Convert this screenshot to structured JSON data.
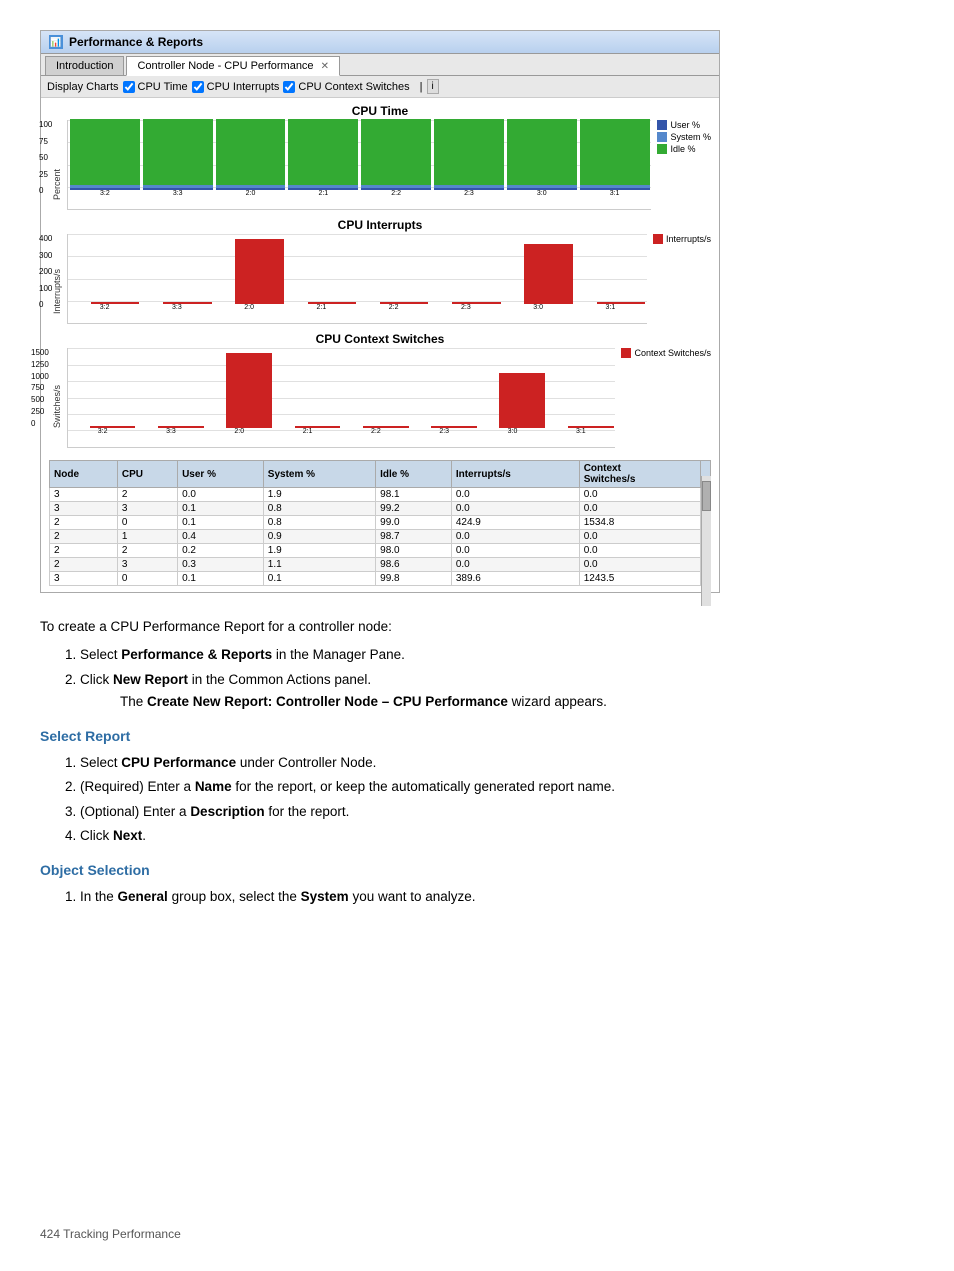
{
  "window": {
    "title": "Performance & Reports",
    "icon": "chart-icon",
    "tabs": [
      {
        "label": "Introduction",
        "active": false
      },
      {
        "label": "Controller Node - CPU Performance",
        "active": true,
        "closable": true
      }
    ]
  },
  "toolbar": {
    "label": "Display Charts",
    "checkboxes": [
      {
        "label": "CPU Time",
        "checked": true
      },
      {
        "label": "CPU Interrupts",
        "checked": true
      },
      {
        "label": "CPU Context Switches",
        "checked": true
      }
    ],
    "button": "i"
  },
  "charts": [
    {
      "title": "CPU Time",
      "ylabel": "Percent",
      "ylabels": [
        "100",
        "75",
        "50",
        "25",
        "0"
      ],
      "legend": [
        {
          "label": "User %",
          "color": "#3355aa"
        },
        {
          "label": "System %",
          "color": "#5588cc"
        },
        {
          "label": "Idle %",
          "color": "#33aa33"
        }
      ],
      "xLabels": [
        "3:2",
        "3:3",
        "2:0",
        "2:1",
        "2:2",
        "2:3",
        "3:0",
        "3:1"
      ],
      "bars": [
        {
          "user": 2,
          "system": 3,
          "idle": 95
        },
        {
          "user": 2,
          "system": 3,
          "idle": 95
        },
        {
          "user": 2,
          "system": 3,
          "idle": 95
        },
        {
          "user": 2,
          "system": 3,
          "idle": 95
        },
        {
          "user": 2,
          "system": 3,
          "idle": 95
        },
        {
          "user": 2,
          "system": 3,
          "idle": 95
        },
        {
          "user": 2,
          "system": 3,
          "idle": 95
        },
        {
          "user": 2,
          "system": 3,
          "idle": 95
        }
      ]
    },
    {
      "title": "CPU Interrupts",
      "ylabel": "Interrupts/s",
      "ylabels": [
        "400",
        "300",
        "200",
        "100",
        "0"
      ],
      "legend": [
        {
          "label": "Interrupts/s",
          "color": "#cc2222"
        }
      ],
      "xLabels": [
        "3:2",
        "3:3",
        "2:0",
        "2:1",
        "2:2",
        "2:3",
        "3:0",
        "3:1"
      ]
    },
    {
      "title": "CPU Context Switches",
      "ylabel": "Switches/s",
      "ylabels": [
        "1500",
        "1250",
        "1000",
        "750",
        "500",
        "250",
        "0"
      ],
      "legend": [
        {
          "label": "Context Switches/s",
          "color": "#cc2222"
        }
      ],
      "xLabels": [
        "3:2",
        "3:3",
        "2:0",
        "2:1",
        "2:2",
        "2:3",
        "3:0",
        "3:1"
      ]
    }
  ],
  "table": {
    "headers": [
      "Node",
      "CPU",
      "User %",
      "System %",
      "Idle %",
      "Interrupts/s",
      "Context Switches/s"
    ],
    "rows": [
      [
        "3",
        "2",
        "0.0",
        "1.9",
        "98.1",
        "0.0",
        "0.0"
      ],
      [
        "3",
        "3",
        "0.1",
        "0.8",
        "99.2",
        "0.0",
        "0.0"
      ],
      [
        "2",
        "0",
        "0.1",
        "0.8",
        "99.0",
        "424.9",
        "1534.8"
      ],
      [
        "2",
        "1",
        "0.4",
        "0.9",
        "98.7",
        "0.0",
        "0.0"
      ],
      [
        "2",
        "2",
        "0.2",
        "1.9",
        "98.0",
        "0.0",
        "0.0"
      ],
      [
        "2",
        "3",
        "0.3",
        "1.1",
        "98.6",
        "0.0",
        "0.0"
      ],
      [
        "3",
        "0",
        "0.1",
        "0.1",
        "99.8",
        "389.6",
        "1243.5"
      ]
    ]
  },
  "body": {
    "intro": "To create a CPU Performance Report for a controller node:",
    "steps": [
      {
        "text": "Select ",
        "bold": "Performance & Reports",
        "rest": " in the Manager Pane."
      },
      {
        "text": "Click ",
        "bold": "New Report",
        "rest": " in the Common Actions panel."
      }
    ],
    "wizard_text": "The ",
    "wizard_bold": "Create New Report: Controller Node – CPU Performance",
    "wizard_rest": " wizard appears.",
    "sections": [
      {
        "heading": "Select Report",
        "steps": [
          {
            "text": "Select ",
            "bold": "CPU Performance",
            "rest": " under Controller Node."
          },
          {
            "text": "(Required) Enter a ",
            "bold": "Name",
            "rest": " for the report, or keep the automatically generated report name."
          },
          {
            "text": "(Optional) Enter a ",
            "bold": "Description",
            "rest": " for the report."
          },
          {
            "text": "Click ",
            "bold": "Next",
            "rest": "."
          }
        ]
      },
      {
        "heading": "Object Selection",
        "steps": [
          {
            "text": "In the ",
            "bold": "General",
            "rest": " group box, select the ",
            "bold2": "System",
            "rest2": " you want to analyze."
          }
        ]
      }
    ]
  },
  "footer": {
    "text": "424    Tracking Performance"
  }
}
